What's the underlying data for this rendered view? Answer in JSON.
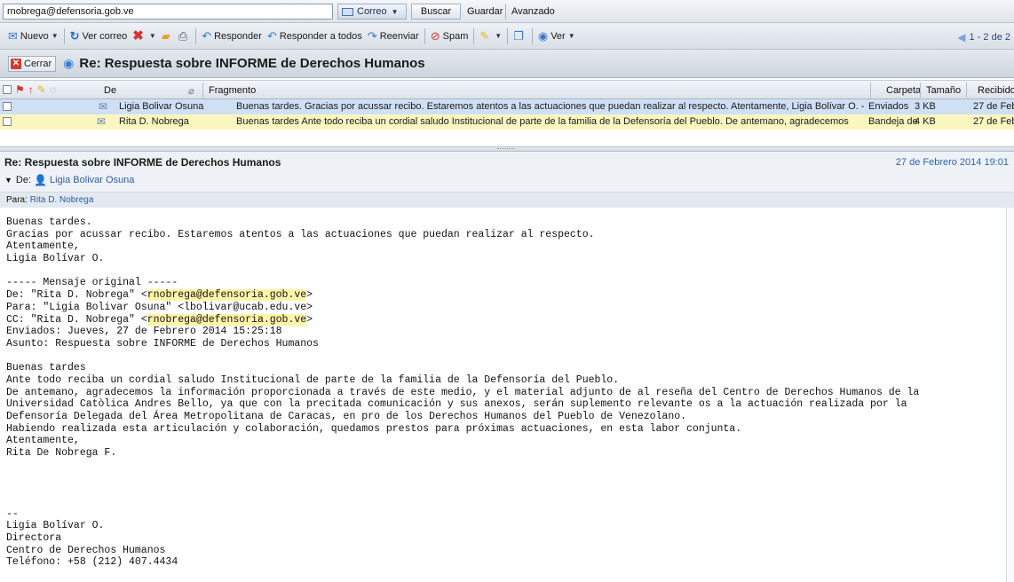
{
  "search": {
    "value": "rnobrega@defensoria.gob.ve"
  },
  "searchbar": {
    "correo_label": "Correo",
    "buscar_label": "Buscar",
    "guardar_label": "Guardar",
    "avanzado_label": "Avanzado"
  },
  "toolbar": {
    "nuevo": "Nuevo",
    "ver_correo": "Ver correo",
    "responder": "Responder",
    "responder_todos": "Responder a todos",
    "reenviar": "Reenviar",
    "spam": "Spam",
    "ver": "Ver",
    "pager": "1 - 2 de 2"
  },
  "conversation": {
    "close_label": "Cerrar",
    "title": "Re: Respuesta sobre INFORME de Derechos Humanos"
  },
  "list": {
    "headers": {
      "de": "De",
      "fragmento": "Fragmento",
      "carpeta": "Carpeta",
      "tamano": "Tamaño",
      "recibido": "Recibido"
    },
    "rows": [
      {
        "from": "Ligia Bolivar Osuna",
        "fragment": "Buenas tardes. Gracias por acussar recibo. Estaremos atentos a las actuaciones que puedan realizar al respecto. Atentamente, Ligia Bolívar O. -- ...",
        "folder": "Enviados",
        "size": "3 KB",
        "received": "27 de Feb"
      },
      {
        "from": "Rita D. Nobrega",
        "fragment": "Buenas tardes Ante todo reciba un cordial saludo Institucional de parte de la familia de la Defensoría del Pueblo. De antemano, agradecemos la ...",
        "folder": "Bandeja de",
        "size": "4 KB",
        "received": "27 de Feb"
      }
    ]
  },
  "reading": {
    "subject": "Re: Respuesta sobre INFORME de Derechos Humanos",
    "date": "27 de Febrero 2014 19:01",
    "from_label": "De:",
    "from_name": "Ligia Bolivar Osuna",
    "to_label": "Para:",
    "to_name": "Rita D. Nobrega"
  },
  "body": {
    "l1": "Buenas tardes.",
    "l2": "Gracias por acussar recibo. Estaremos atentos a las actuaciones que puedan realizar al respecto.",
    "l3": "Atentamente,",
    "l4": "Ligia Bolívar O.",
    "l5": "----- Mensaje original -----",
    "l6a": "De: \"Rita D. Nobrega\" <",
    "l6b": "rnobrega@defensoria.gob.ve",
    "l6c": ">",
    "l7": "Para: \"Ligia Bolivar Osuna\" <lbolivar@ucab.edu.ve>",
    "l8a": "CC: \"Rita D. Nobrega\" <",
    "l8b": "rnobrega@defensoria.gob.ve",
    "l8c": ">",
    "l9": "Enviados: Jueves, 27 de Febrero 2014 15:25:18",
    "l10": "Asunto: Respuesta sobre INFORME de Derechos Humanos",
    "l11": "Buenas tardes",
    "l12": "Ante todo reciba un cordial saludo Institucional de parte de la familia de la Defensoría del Pueblo.",
    "l13": "De antemano, agradecemos la información proporcionada a través de este medio, y el material adjunto de al reseña del Centro de Derechos Humanos de la",
    "l14": "Universidad Catòlica Andres Bello, ya que con la precitada comunicación y sus anexos, serán suplemento relevante os a la actuación realizada por la",
    "l15": "Defensoría Delegada del Área Metropolitana de Caracas, en pro de los Derechos Humanos del Pueblo de Venezolano.",
    "l16": "Habiendo realizada esta articulación y colaboración, quedamos prestos para próximas actuaciones, en esta labor conjunta.",
    "l17": "Atentamente,",
    "l18": "Rita De Nobrega F.",
    "l19": "--",
    "l20": "Ligia Bolívar O.",
    "l21": "Directora",
    "l22": "Centro de Derechos Humanos",
    "l23": "Teléfono: +58 (212) 407.4434"
  }
}
